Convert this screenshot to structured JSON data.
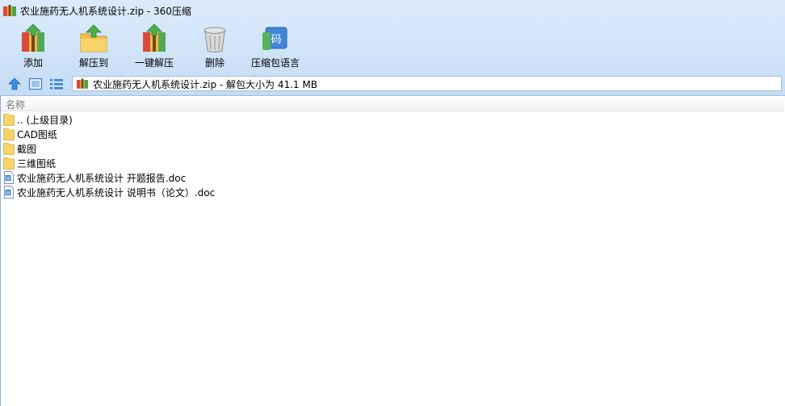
{
  "window": {
    "title": "农业施药无人机系统设计.zip - 360压缩"
  },
  "toolbar": {
    "items": [
      {
        "label": "添加",
        "icon": "add-archive-icon"
      },
      {
        "label": "解压到",
        "icon": "extract-to-icon"
      },
      {
        "label": "一键解压",
        "icon": "one-click-extract-icon"
      },
      {
        "label": "删除",
        "icon": "trash-icon"
      },
      {
        "label": "压缩包语言",
        "icon": "archive-language-icon"
      }
    ]
  },
  "address": {
    "text": "农业施药无人机系统设计.zip - 解包大小为 41.1 MB"
  },
  "list": {
    "header": "名称",
    "rows": [
      {
        "name": ".. (上级目录)",
        "type": "folder"
      },
      {
        "name": "CAD图纸",
        "type": "folder"
      },
      {
        "name": "截图",
        "type": "folder"
      },
      {
        "name": "三维图纸",
        "type": "folder"
      },
      {
        "name": "农业施药无人机系统设计 开题报告.doc",
        "type": "doc"
      },
      {
        "name": "农业施药无人机系统设计 说明书（论文）.doc",
        "type": "doc"
      }
    ]
  },
  "colors": {
    "chrome": "#cfe3f8",
    "folder": "#f7d36b",
    "doc": "#3a7fd0"
  }
}
